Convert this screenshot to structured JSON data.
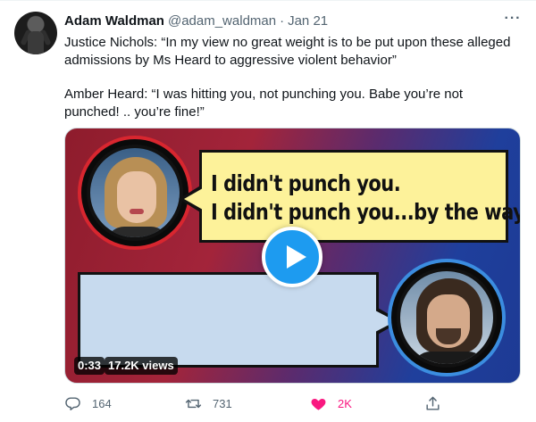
{
  "tweet": {
    "author_name": "Adam Waldman",
    "author_handle": "@adam_waldman",
    "separator": "·",
    "date": "Jan 21",
    "more_label": "···",
    "paragraphs": [
      "Justice Nichols: “In my view no great weight is to be put upon these alleged admissions by Ms Heard to aggressive violent behavior”",
      "Amber Heard: “I was hitting you, not punching you. Babe you’re not punched! .. you’re fine!”"
    ]
  },
  "media": {
    "bubble_line_1": "I didn't punch you.",
    "bubble_line_2": "I didn't punch you...by the way...",
    "duration": "0:33",
    "views": "17.2K views"
  },
  "actions": {
    "replies": "164",
    "retweets": "731",
    "likes": "2K"
  },
  "colors": {
    "accent": "#1d9bf0",
    "like": "#f91880",
    "muted": "#536471"
  }
}
